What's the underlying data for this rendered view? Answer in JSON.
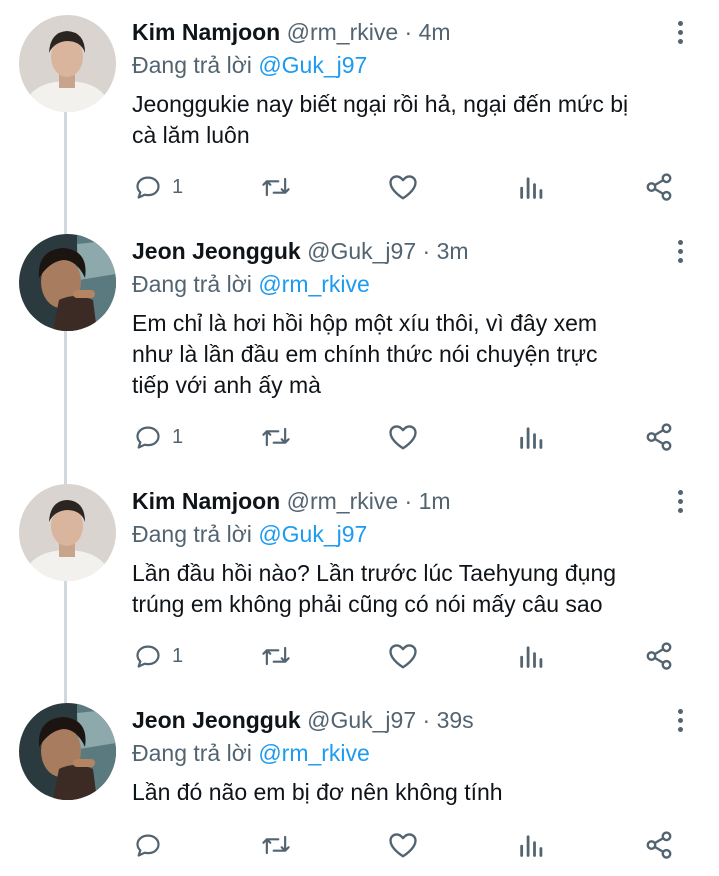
{
  "tweets": [
    {
      "name": "Kim Namjoon",
      "handle": "@rm_rkive",
      "dot": "·",
      "time": "4m",
      "reply_prefix": "Đang trả lời",
      "reply_to": "@Guk_j97",
      "text_lines": [
        "Jeonggukie nay biết ngại rồi hả, ngại đến mức bị",
        "cà lăm luôn"
      ],
      "reply_count": "1"
    },
    {
      "name": "Jeon Jeongguk",
      "handle": "@Guk_j97",
      "dot": "·",
      "time": "3m",
      "reply_prefix": "Đang trả lời",
      "reply_to": "@rm_rkive",
      "text_lines": [
        "Em chỉ là hơi hồi hộp một xíu thôi, vì đây xem",
        "như là lần đầu em chính thức nói chuyện trực",
        "tiếp với anh ấy mà"
      ],
      "reply_count": "1"
    },
    {
      "name": "Kim Namjoon",
      "handle": "@rm_rkive",
      "dot": "·",
      "time": "1m",
      "reply_prefix": "Đang trả lời",
      "reply_to": "@Guk_j97",
      "text_lines": [
        "Lần đầu hồi nào? Lần trước lúc Taehyung đụng",
        "trúng em không phải cũng có nói mấy câu sao"
      ],
      "reply_count": "1"
    },
    {
      "name": "Jeon Jeongguk",
      "handle": "@Guk_j97",
      "dot": "·",
      "time": "39s",
      "reply_prefix": "Đang trả lời",
      "reply_to": "@rm_rkive",
      "text_lines": [
        "Lần đó não em bị đơ nên không tính"
      ],
      "reply_count": ""
    }
  ],
  "icons": {
    "reply": "reply-icon",
    "retweet": "retweet-icon",
    "like": "heart-icon",
    "analytics": "analytics-icon",
    "share": "share-icon",
    "more": "more-vertical-icon"
  },
  "colors": {
    "text": "#0f1419",
    "secondary": "#536471",
    "mention": "#1d9bf0",
    "thread_line": "#cfd9de"
  }
}
